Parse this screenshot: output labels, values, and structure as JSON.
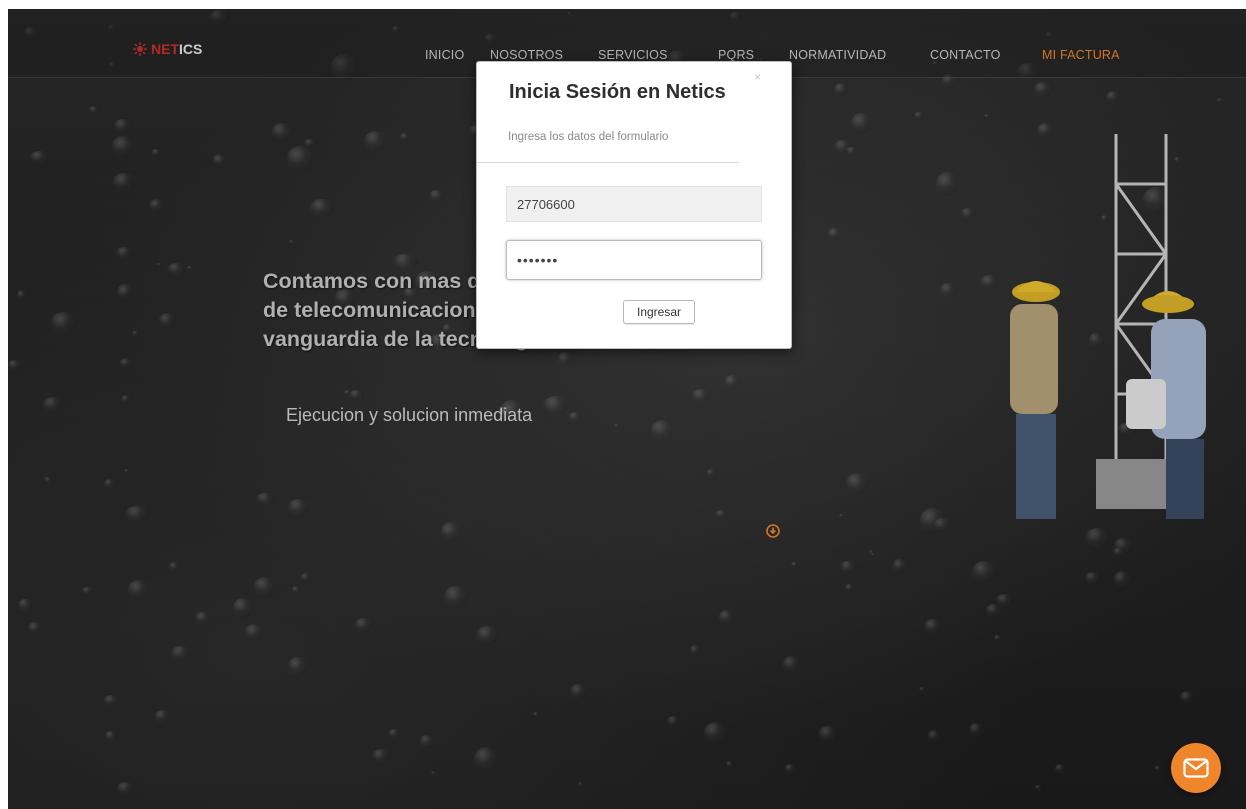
{
  "brand": {
    "logo_prefix": "NET",
    "logo_suffix": "ICS"
  },
  "nav": {
    "items": [
      {
        "label": "INICIO",
        "active": false
      },
      {
        "label": "NOSOTROS",
        "active": false
      },
      {
        "label": "SERVICIOS",
        "active": false
      },
      {
        "label": "PQRS",
        "active": false
      },
      {
        "label": "NORMATIVIDAD",
        "active": false
      },
      {
        "label": "CONTACTO",
        "active": false
      },
      {
        "label": "MI FACTURA",
        "active": true
      }
    ]
  },
  "hero": {
    "headline_lines": [
      "Contamos con mas de 10 años en el area",
      "de telecomunicaciones y siempre a la",
      "vanguardia de la tecnologia"
    ],
    "subheadline": "Ejecucion y solucion inmediata"
  },
  "login_modal": {
    "title": "Inicia Sesión en Netics",
    "subtitle": "Ingresa los datos del formulario",
    "close_symbol": "×",
    "username_value": "27706600",
    "password_value": "•••••••",
    "submit_label": "Ingresar"
  },
  "icons": {
    "scroll_down": "circle-arrow-down-icon",
    "chat": "envelope-icon"
  },
  "colors": {
    "accent": "#f0862c",
    "background": "#232323",
    "logo_red": "#c9302c"
  }
}
